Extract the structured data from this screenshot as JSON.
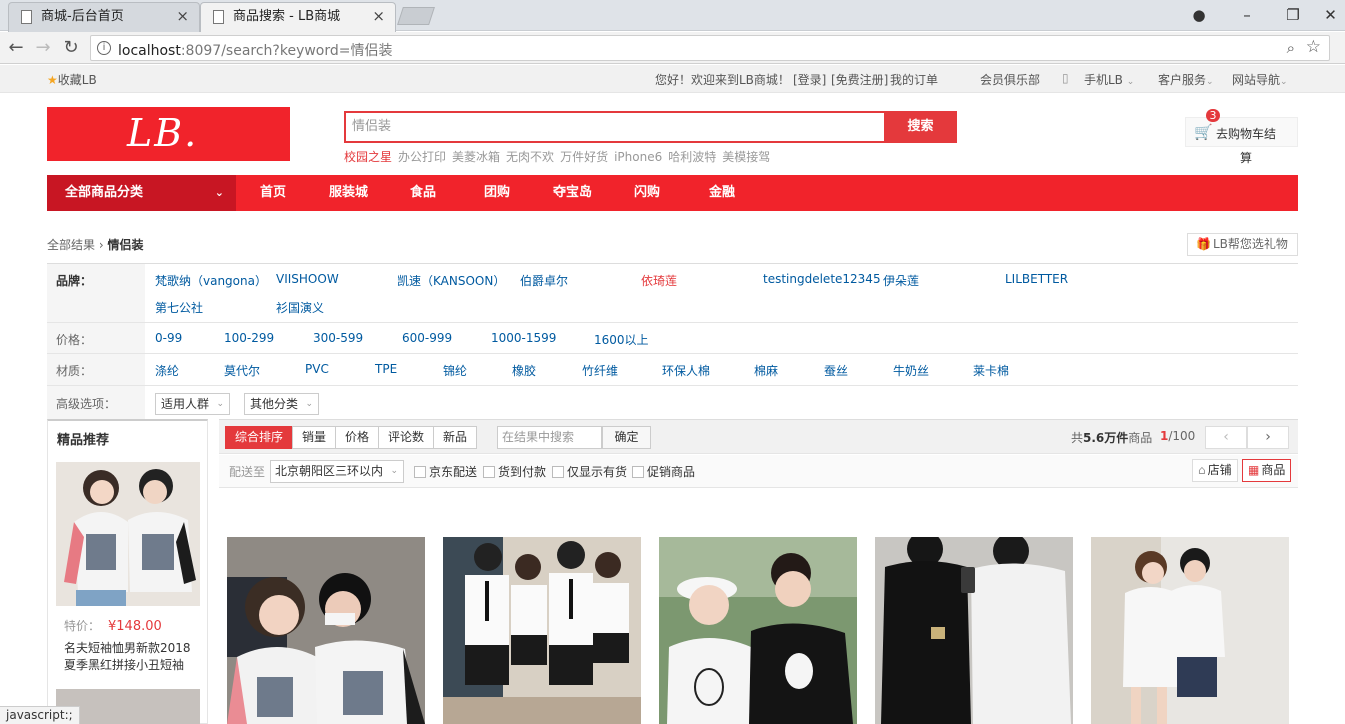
{
  "browser": {
    "tabs": [
      {
        "label": "商城-后台首页"
      },
      {
        "label": "商品搜索 - LB商城"
      }
    ],
    "url_host": "localhost",
    "url_rest": ":8097/search?keyword=情侣装",
    "status_text": "javascript:;"
  },
  "topbar": {
    "favorite": "收藏LB",
    "welcome": "您好！欢迎来到LB商城！",
    "login": "[登录]",
    "register": "[免费注册]",
    "my_orders": "我的订单",
    "club": "会员俱乐部",
    "mobile": "手机LB",
    "service": "客户服务",
    "sitenav": "网站导航"
  },
  "header": {
    "logo_text": "LB.",
    "search_value": "情侣装",
    "search_button": "搜索",
    "hotwords": [
      "校园之星",
      "办公打印",
      "美菱冰箱",
      "无肉不欢",
      "万件好货",
      "iPhone6",
      "哈利波特",
      "美模接驾"
    ],
    "cart_label": "去购物车结",
    "cart_label_wrap": "算",
    "cart_count": "3"
  },
  "nav": {
    "all_categories": "全部商品分类",
    "links": [
      "首页",
      "服装城",
      "食品",
      "团购",
      "夺宝岛",
      "闪购",
      "金融"
    ]
  },
  "breadcrumb": {
    "root": "全部结果",
    "current": "情侣装",
    "gift": "LB帮您选礼物"
  },
  "filters": {
    "brand_label": "品牌：",
    "brands": [
      "梵歌纳（vangona）",
      "VIISHOOW",
      "凯速（KANSOON）",
      "伯爵卓尔",
      "依琦莲",
      "testingdelete12345",
      "伊朵莲",
      "LILBETTER",
      "第七公社",
      "衫国演义"
    ],
    "price_label": "价格：",
    "prices": [
      "0-99",
      "100-299",
      "300-599",
      "600-999",
      "1000-1599",
      "1600以上"
    ],
    "material_label": "材质：",
    "materials": [
      "涤纶",
      "莫代尔",
      "PVC",
      "TPE",
      "锦纶",
      "橡胶",
      "竹纤维",
      "环保人棉",
      "棉麻",
      "蚕丝",
      "牛奶丝",
      "莱卡棉"
    ],
    "advanced_label": "高级选项：",
    "advanced": [
      "适用人群",
      "其他分类"
    ]
  },
  "sidebar": {
    "title": "精品推荐",
    "price_label": "特价：",
    "price": "¥148.00",
    "name": "名夫短袖恤男新款2018夏季黑红拼接小丑短袖"
  },
  "sortbar": {
    "options": [
      "综合排序",
      "销量",
      "价格",
      "评论数",
      "新品"
    ],
    "search_placeholder": "在结果中搜索",
    "confirm": "确定",
    "total_prefix": "共",
    "total_count": "5.6万件",
    "total_suffix": "商品",
    "page_current": "1",
    "page_total": "/100",
    "prev": "‹",
    "next": "›"
  },
  "deliver": {
    "label": "配送至",
    "location": "北京朝阳区三环以内",
    "checks": [
      "京东配送",
      "货到付款",
      "仅显示有货",
      "促销商品"
    ],
    "view_store": "店铺",
    "view_goods": "商品"
  },
  "colors": {
    "brand_red": "#f1232b",
    "accent_red": "#e4393c",
    "link_blue": "#005aa0"
  }
}
